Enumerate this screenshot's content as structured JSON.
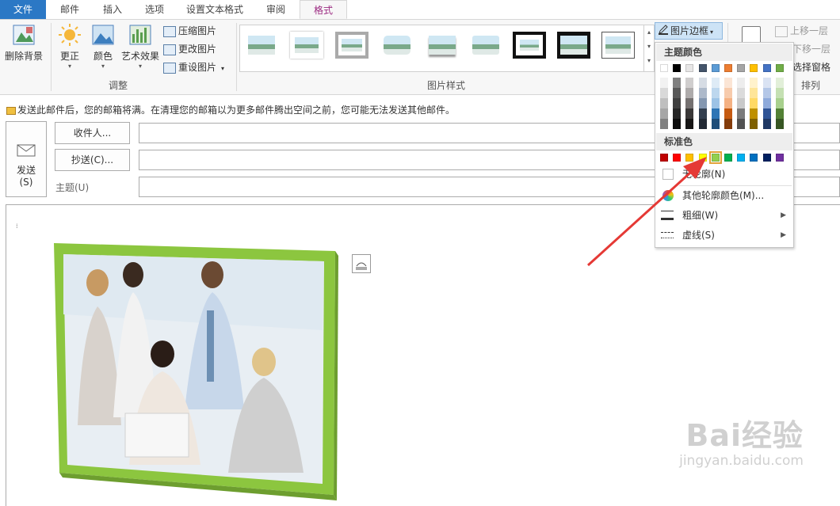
{
  "tabs": [
    {
      "label": "文件"
    },
    {
      "label": "邮件"
    },
    {
      "label": "插入"
    },
    {
      "label": "选项"
    },
    {
      "label": "设置文本格式"
    },
    {
      "label": "审阅"
    },
    {
      "label": "格式"
    }
  ],
  "ribbon": {
    "remove_bg": "删除背景",
    "corrections": "更正",
    "color": "颜色",
    "artistic": "艺术效果",
    "compress": "压缩图片",
    "change": "更改图片",
    "reset": "重设图片",
    "group_adjust": "调整",
    "group_styles": "图片样式",
    "border_btn": "图片边框",
    "bring_forward": "上移一层",
    "send_backward": "下移一层",
    "selection_pane": "选择窗格",
    "group_arrange": "排列"
  },
  "infobar": {
    "text": "发送此邮件后，您的邮箱将满。在清理您的邮箱以为更多邮件腾出空间之前，您可能无法发送其他邮件。"
  },
  "compose": {
    "send_line1": "发送",
    "send_line2": "(S)",
    "to_btn": "收件人...",
    "cc_btn": "抄送(C)...",
    "subject_label": "主题(U)"
  },
  "dropdown": {
    "theme_colors_label": "主题颜色",
    "standard_colors_label": "标准色",
    "no_outline": "无轮廓(N)",
    "more_colors": "其他轮廓颜色(M)...",
    "weight": "粗细(W)",
    "dashes": "虚线(S)",
    "theme_top": [
      "#ffffff",
      "#000000",
      "#e7e6e6",
      "#44546a",
      "#5b9bd5",
      "#ed7d31",
      "#a5a5a5",
      "#ffc000",
      "#4472c4",
      "#70ad47"
    ],
    "theme_shades": [
      [
        "#f2f2f2",
        "#d9d9d9",
        "#bfbfbf",
        "#a6a6a6",
        "#808080"
      ],
      [
        "#808080",
        "#595959",
        "#404040",
        "#262626",
        "#0d0d0d"
      ],
      [
        "#d0cece",
        "#aeabab",
        "#757171",
        "#3a3838",
        "#171616"
      ],
      [
        "#d6dce4",
        "#adb9ca",
        "#8497b0",
        "#333f4f",
        "#222a35"
      ],
      [
        "#deebf6",
        "#bdd7ee",
        "#9dc3e6",
        "#2e75b5",
        "#1f4e79"
      ],
      [
        "#fbe5d5",
        "#f7cbac",
        "#f4b183",
        "#c55a11",
        "#843c0b"
      ],
      [
        "#ededed",
        "#dbdbdb",
        "#c9c9c9",
        "#7b7b7b",
        "#525252"
      ],
      [
        "#fff2cc",
        "#fee599",
        "#ffd965",
        "#bf9000",
        "#7f6000"
      ],
      [
        "#dae3f3",
        "#b4c7e7",
        "#8eaadb",
        "#2f5496",
        "#1f3864"
      ],
      [
        "#e2efd9",
        "#c5e0b3",
        "#a8d08d",
        "#538135",
        "#375623"
      ]
    ],
    "standard": [
      "#c00000",
      "#ff0000",
      "#ffc000",
      "#ffff00",
      "#92d050",
      "#00b050",
      "#00b0f0",
      "#0070c0",
      "#002060",
      "#7030a0"
    ]
  },
  "image": {
    "frame_color": "#8cc63f"
  },
  "watermark": {
    "brand": "Bai经验",
    "url": "jingyan.baidu.com"
  },
  "accent": {
    "arrow": "#e53935",
    "file_tab": "#2b78c5",
    "format_tab_text": "#9c2b82"
  }
}
